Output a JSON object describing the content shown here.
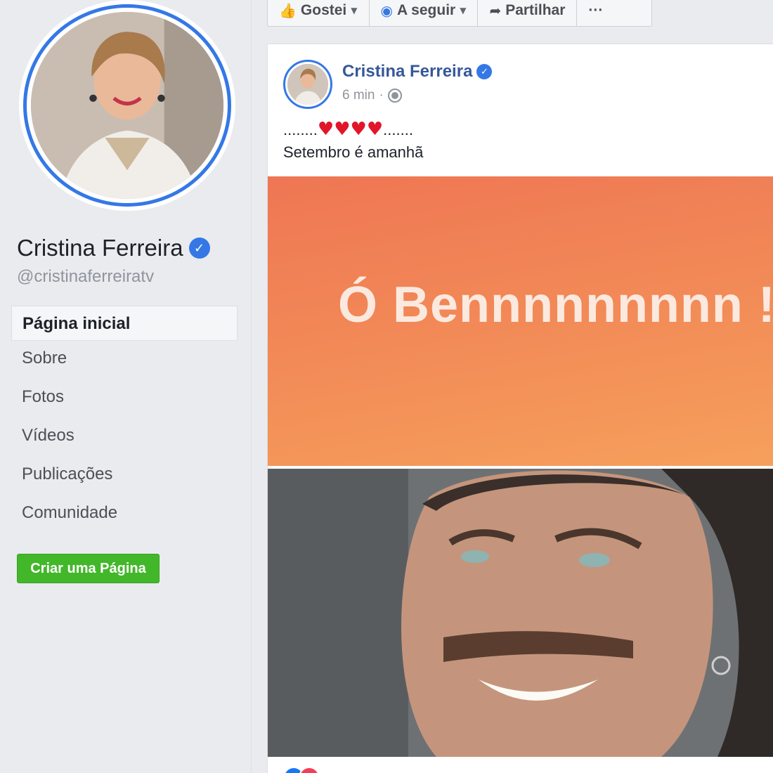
{
  "sidebar": {
    "page_name": "Cristina Ferreira",
    "handle": "@cristinaferreiratv",
    "verified_icon": "verified-check-icon",
    "nav": [
      {
        "label": "Página inicial",
        "active": true
      },
      {
        "label": "Sobre",
        "active": false
      },
      {
        "label": "Fotos",
        "active": false
      },
      {
        "label": "Vídeos",
        "active": false
      },
      {
        "label": "Publicações",
        "active": false
      },
      {
        "label": "Comunidade",
        "active": false
      }
    ],
    "create_page_label": "Criar uma Página"
  },
  "action_bar": {
    "like_label": "Gostei",
    "follow_label": "A seguir",
    "share_label": "Partilhar",
    "more_label": "···"
  },
  "post": {
    "author": "Cristina Ferreira",
    "time": "6 min",
    "separator": "·",
    "text_line1_prefix": "........",
    "text_hearts": "♥♥♥♥",
    "text_line1_suffix": ".......",
    "text_line2": "Setembro é amanhã",
    "banner_text": "Ó Bennnnnnnnn !"
  },
  "colors": {
    "accent": "#3578e5",
    "link": "#365899",
    "create_button": "#42b72a",
    "banner": "#f28a57",
    "heart": "#e0162b"
  }
}
